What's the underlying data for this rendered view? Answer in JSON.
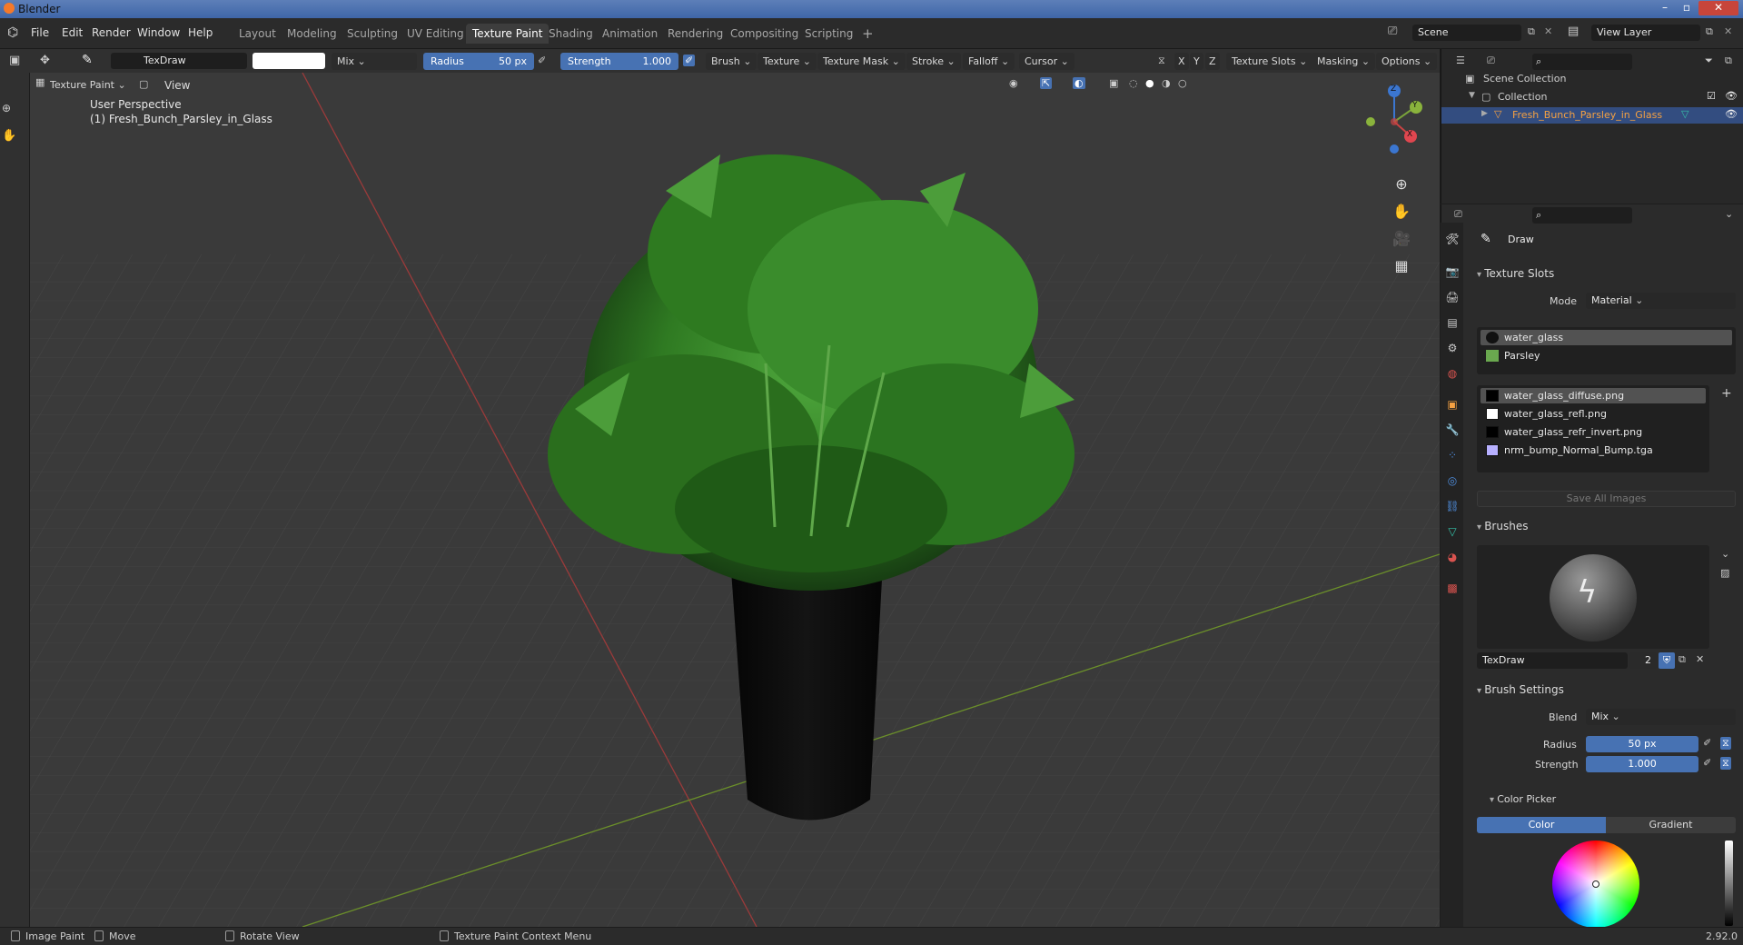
{
  "window": {
    "title": "Blender",
    "version": "2.92.0"
  },
  "menu": {
    "file": "File",
    "edit": "Edit",
    "render": "Render",
    "window": "Window",
    "help": "Help"
  },
  "workspaces": [
    "Layout",
    "Modeling",
    "Sculpting",
    "UV Editing",
    "Texture Paint",
    "Shading",
    "Animation",
    "Rendering",
    "Compositing",
    "Scripting"
  ],
  "active_workspace": "Texture Paint",
  "scene": {
    "name": "Scene",
    "view_layer": "View Layer"
  },
  "tool_header": {
    "brush_name": "TexDraw",
    "blend": "Mix",
    "radius_label": "Radius",
    "radius_value": "50 px",
    "strength_label": "Strength",
    "strength_value": "1.000",
    "menus": [
      "Brush",
      "Texture",
      "Texture Mask",
      "Stroke",
      "Falloff",
      "Cursor"
    ],
    "axes": [
      "X",
      "Y",
      "Z"
    ],
    "texture_slots": "Texture Slots",
    "masking": "Masking",
    "options": "Options"
  },
  "viewport": {
    "mode": "Texture Paint",
    "view_menu": "View",
    "perspective": "User Perspective",
    "object_label": "(1) Fresh_Bunch_Parsley_in_Glass",
    "gizmo": {
      "x": "X",
      "y": "Y",
      "z": "Z"
    }
  },
  "outliner": {
    "scene_collection": "Scene Collection",
    "collection": "Collection",
    "object": "Fresh_Bunch_Parsley_in_Glass"
  },
  "properties": {
    "tool_name": "Draw",
    "texture_slots": {
      "header": "Texture Slots",
      "mode_label": "Mode",
      "mode_value": "Material",
      "materials": [
        {
          "name": "water_glass",
          "color": "#111111"
        },
        {
          "name": "Parsley",
          "color": "#6aa84f"
        }
      ],
      "images": [
        {
          "name": "water_glass_diffuse.png",
          "color": "#000000"
        },
        {
          "name": "water_glass_refl.png",
          "color": "#ffffff"
        },
        {
          "name": "water_glass_refr_invert.png",
          "color": "#000000"
        },
        {
          "name": "nrm_bump_Normal_Bump.tga",
          "color": "#b7b0ff"
        }
      ],
      "save_all": "Save All Images"
    },
    "brushes": {
      "header": "Brushes",
      "brush_name": "TexDraw",
      "users": "2"
    },
    "brush_settings": {
      "header": "Brush Settings",
      "blend_label": "Blend",
      "blend_value": "Mix",
      "radius_label": "Radius",
      "radius_value": "50 px",
      "strength_label": "Strength",
      "strength_value": "1.000"
    },
    "color_picker": {
      "header": "Color Picker",
      "tab_color": "Color",
      "tab_gradient": "Gradient"
    }
  },
  "statusbar": {
    "left": "Image Paint",
    "move": "Move",
    "rotate": "Rotate View",
    "context": "Texture Paint Context Menu"
  },
  "colors": {
    "accent": "#4772b3",
    "active_object": "#f5a142",
    "viewport_bg": "#3a3a3a"
  }
}
